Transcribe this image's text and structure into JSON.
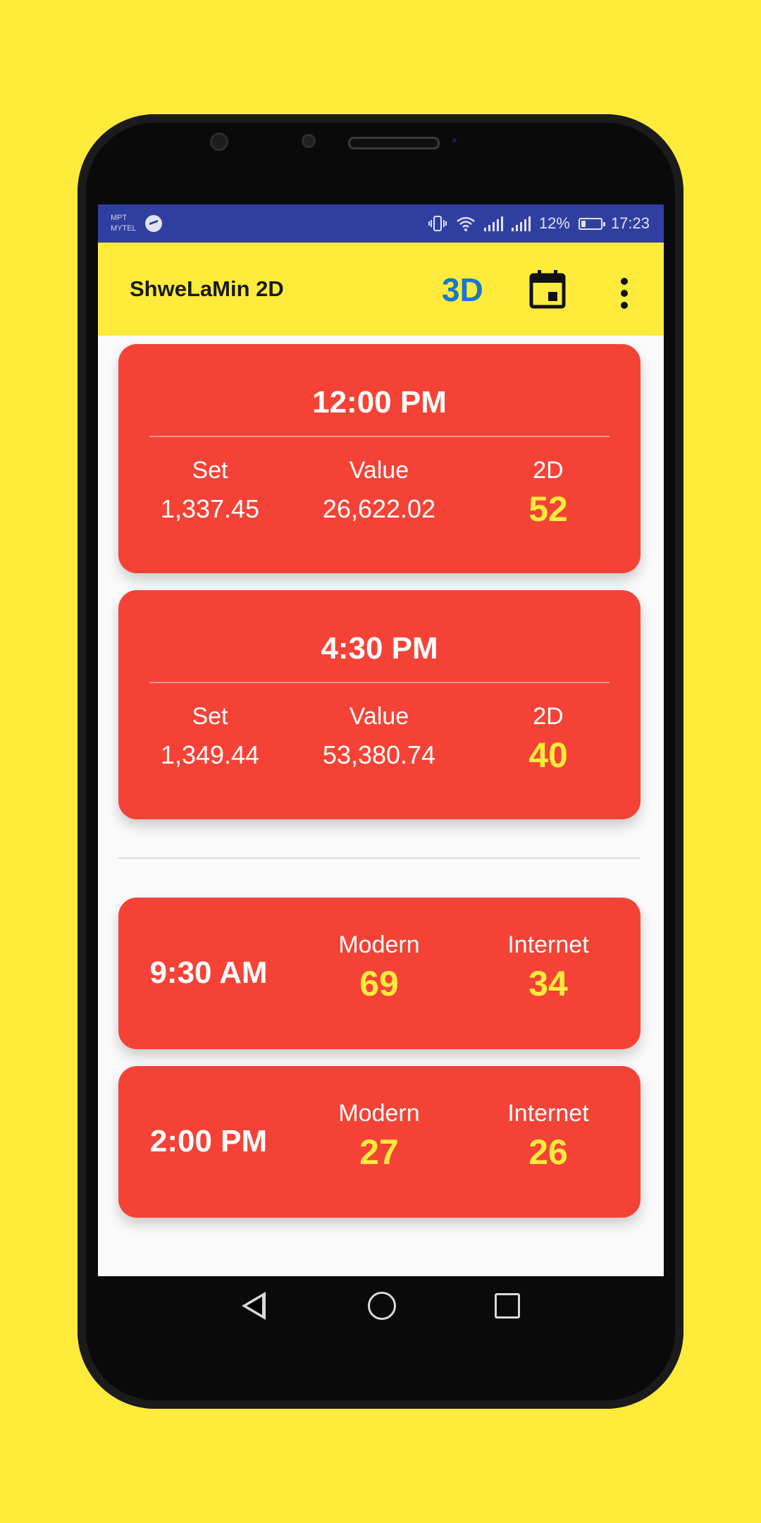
{
  "statusbar": {
    "carrier1": "MPT",
    "carrier2": "MYTEL",
    "battery": "12%",
    "time": "17:23",
    "icons": [
      "messenger-icon",
      "vibrate-icon",
      "wifi-icon",
      "signal-icon",
      "battery-icon"
    ]
  },
  "appbar": {
    "title": "ShweLaMin 2D",
    "btn_3d": "3D",
    "calendar_icon": "calendar-icon",
    "menu_icon": "more-vert-icon"
  },
  "results": [
    {
      "time": "12:00 PM",
      "set_label": "Set",
      "set_value": "1,337.45",
      "value_label": "Value",
      "value": "26,622.02",
      "twod_label": "2D",
      "twod": "52"
    },
    {
      "time": "4:30 PM",
      "set_label": "Set",
      "set_value": "1,349.44",
      "value_label": "Value",
      "value": "53,380.74",
      "twod_label": "2D",
      "twod": "40"
    }
  ],
  "modern_internet": [
    {
      "time": "9:30 AM",
      "modern_label": "Modern",
      "modern": "69",
      "internet_label": "Internet",
      "internet": "34"
    },
    {
      "time": "2:00 PM",
      "modern_label": "Modern",
      "modern": "27",
      "internet_label": "Internet",
      "internet": "26"
    }
  ],
  "colors": {
    "background": "#FFEB3B",
    "card": "#F44336",
    "accent_3d": "#1976D2",
    "statusbar": "#303F9F",
    "highlight": "#FFEB3B"
  }
}
